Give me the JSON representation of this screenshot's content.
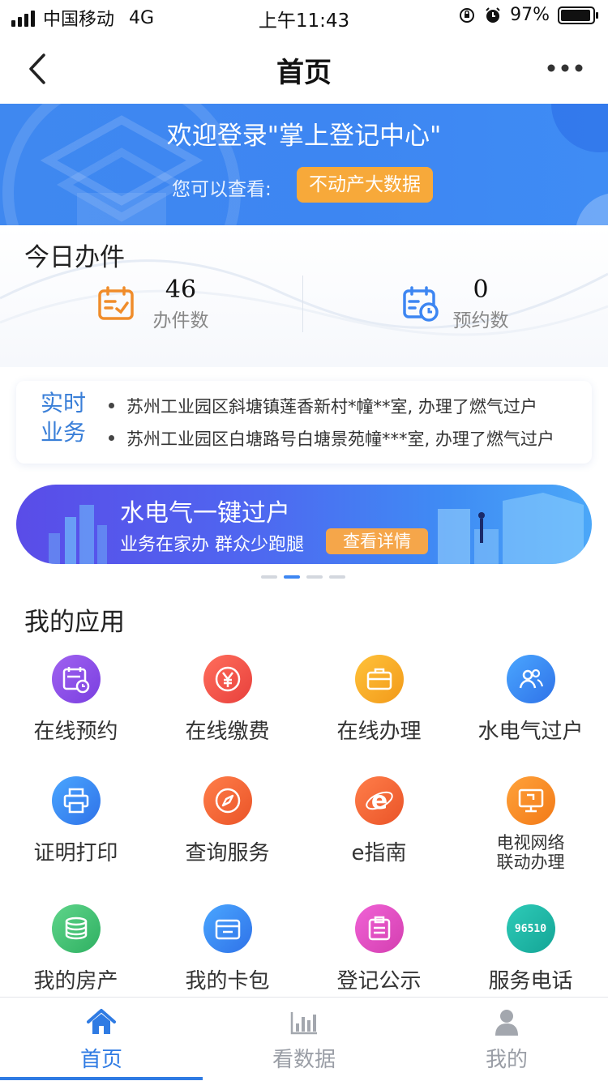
{
  "status_bar": {
    "carrier": "中国移动",
    "network": "4G",
    "time": "上午11:43",
    "battery": "97%"
  },
  "nav": {
    "title": "首页"
  },
  "banner": {
    "title": "欢迎登录\"掌上登记中心\"",
    "subtitle": "您可以查看:",
    "button": "不动产大数据"
  },
  "today": {
    "title": "今日办件",
    "stats": [
      {
        "value": "46",
        "label": "办件数",
        "icon": "calendar-check-icon",
        "color": "#f08c2a"
      },
      {
        "value": "0",
        "label": "预约数",
        "icon": "calendar-clock-icon",
        "color": "#3d86f2"
      }
    ]
  },
  "realtime": {
    "label": "实时业务",
    "items": [
      "苏州工业园区斜塘镇莲香新村*幢**室, 办理了燃气过户",
      "苏州工业园区白塘路号白塘景苑幢***室, 办理了燃气过户"
    ]
  },
  "promo": {
    "title": "水电气一键过户",
    "subtitle": "业务在家办 群众少跑腿",
    "button": "查看详情",
    "dots_total": 4,
    "dots_active": 1
  },
  "apps": {
    "title": "我的应用",
    "items": [
      {
        "label": "在线预约",
        "icon": "calendar-clock-icon",
        "color": "#8a4fe6"
      },
      {
        "label": "在线缴费",
        "icon": "yuan-icon",
        "color": "#f0534c"
      },
      {
        "label": "在线办理",
        "icon": "briefcase-icon",
        "color": "#f5a423"
      },
      {
        "label": "水电气过户",
        "icon": "users-icon",
        "color": "#3d8cf2"
      },
      {
        "label": "证明打印",
        "icon": "printer-icon",
        "color": "#3d8cf2"
      },
      {
        "label": "查询服务",
        "icon": "compass-icon",
        "color": "#f06a3a"
      },
      {
        "label": "e指南",
        "icon": "e-guide-icon",
        "color": "#f06a3a"
      },
      {
        "label": "电视网络联动办理",
        "label_line1": "电视网络",
        "label_line2": "联动办理",
        "icon": "monitor-icon",
        "color": "#f5872a"
      },
      {
        "label": "我的房产",
        "icon": "coins-icon",
        "color": "#3ebf70"
      },
      {
        "label": "我的卡包",
        "icon": "wallet-icon",
        "color": "#3d8cf2"
      },
      {
        "label": "登记公示",
        "icon": "notice-icon",
        "color": "#e84cbf"
      },
      {
        "label": "服务电话",
        "icon": "hotline-icon",
        "badge": "96510",
        "color": "#22b8a8"
      }
    ]
  },
  "tabs": [
    {
      "label": "首页",
      "icon": "home-icon",
      "active": true
    },
    {
      "label": "看数据",
      "icon": "bar-chart-icon",
      "active": false
    },
    {
      "label": "我的",
      "icon": "user-icon",
      "active": false
    }
  ],
  "colors": {
    "primary": "#3d86f2",
    "accent_orange": "#f7a93a",
    "tab_active": "#2f7be3"
  }
}
